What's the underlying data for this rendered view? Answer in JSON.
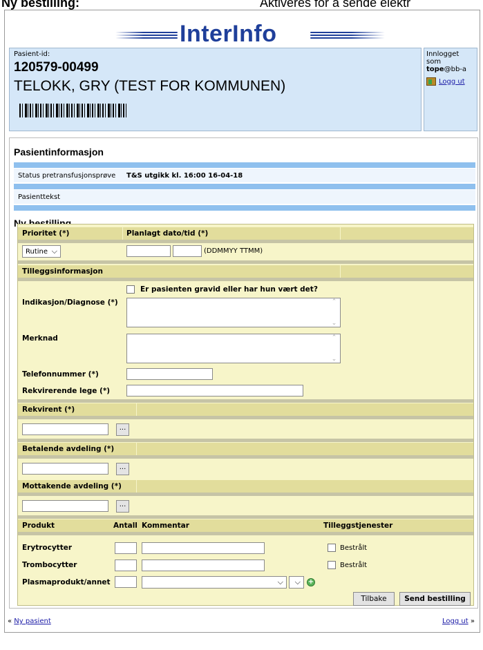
{
  "caption": {
    "left": "Ny bestilling:",
    "right": "Aktiveres for å sende elektr"
  },
  "app": {
    "logo": "InterInfo"
  },
  "patient": {
    "id_label": "Pasient-id:",
    "id": "120579-00499",
    "name": "TELOKK, GRY (TEST FOR KOMMUNEN)"
  },
  "login": {
    "label": "Innlogget som",
    "user_bold": "tope",
    "user_rest": "@bb-a",
    "logout": "Logg ut"
  },
  "patient_info": {
    "title": "Pasientinformasjon",
    "status_label": "Status pretransfusjonsprøve",
    "status_value": "T&S utgikk kl. 16:00 16-04-18",
    "patient_text_label": "Pasienttekst"
  },
  "order": {
    "title": "Ny bestilling",
    "priority_header": "Prioritet (*)",
    "planned_header": "Planlagt dato/tid (*)",
    "priority_value": "Rutine",
    "date_format_hint": "(DDMMYY TTMM)",
    "extra_header": "Tilleggsinformasjon",
    "pregnant_label": "Er pasienten gravid eller har hun vært det?",
    "indication_label": "Indikasjon/Diagnose (*)",
    "remark_label": "Merknad",
    "phone_label": "Telefonnummer (*)",
    "requesting_doctor_label": "Rekvirerende lege (*)",
    "requester_header": "Rekvirent (*)",
    "paying_dept_header": "Betalende avdeling (*)",
    "receiving_dept_header": "Mottakende avdeling (*)",
    "browse_label": "...",
    "product_header": "Produkt",
    "quantity_header": "Antall",
    "comment_header": "Kommentar",
    "extra_services_header": "Tilleggstjenester",
    "products": [
      "Erytrocytter",
      "Trombocytter",
      "Plasmaprodukt/annet"
    ],
    "irradiated_label": "Bestrålt",
    "back_button": "Tilbake",
    "send_button": "Send bestilling"
  },
  "footer": {
    "new_patient": "Ny pasient",
    "logout": "Logg ut"
  }
}
